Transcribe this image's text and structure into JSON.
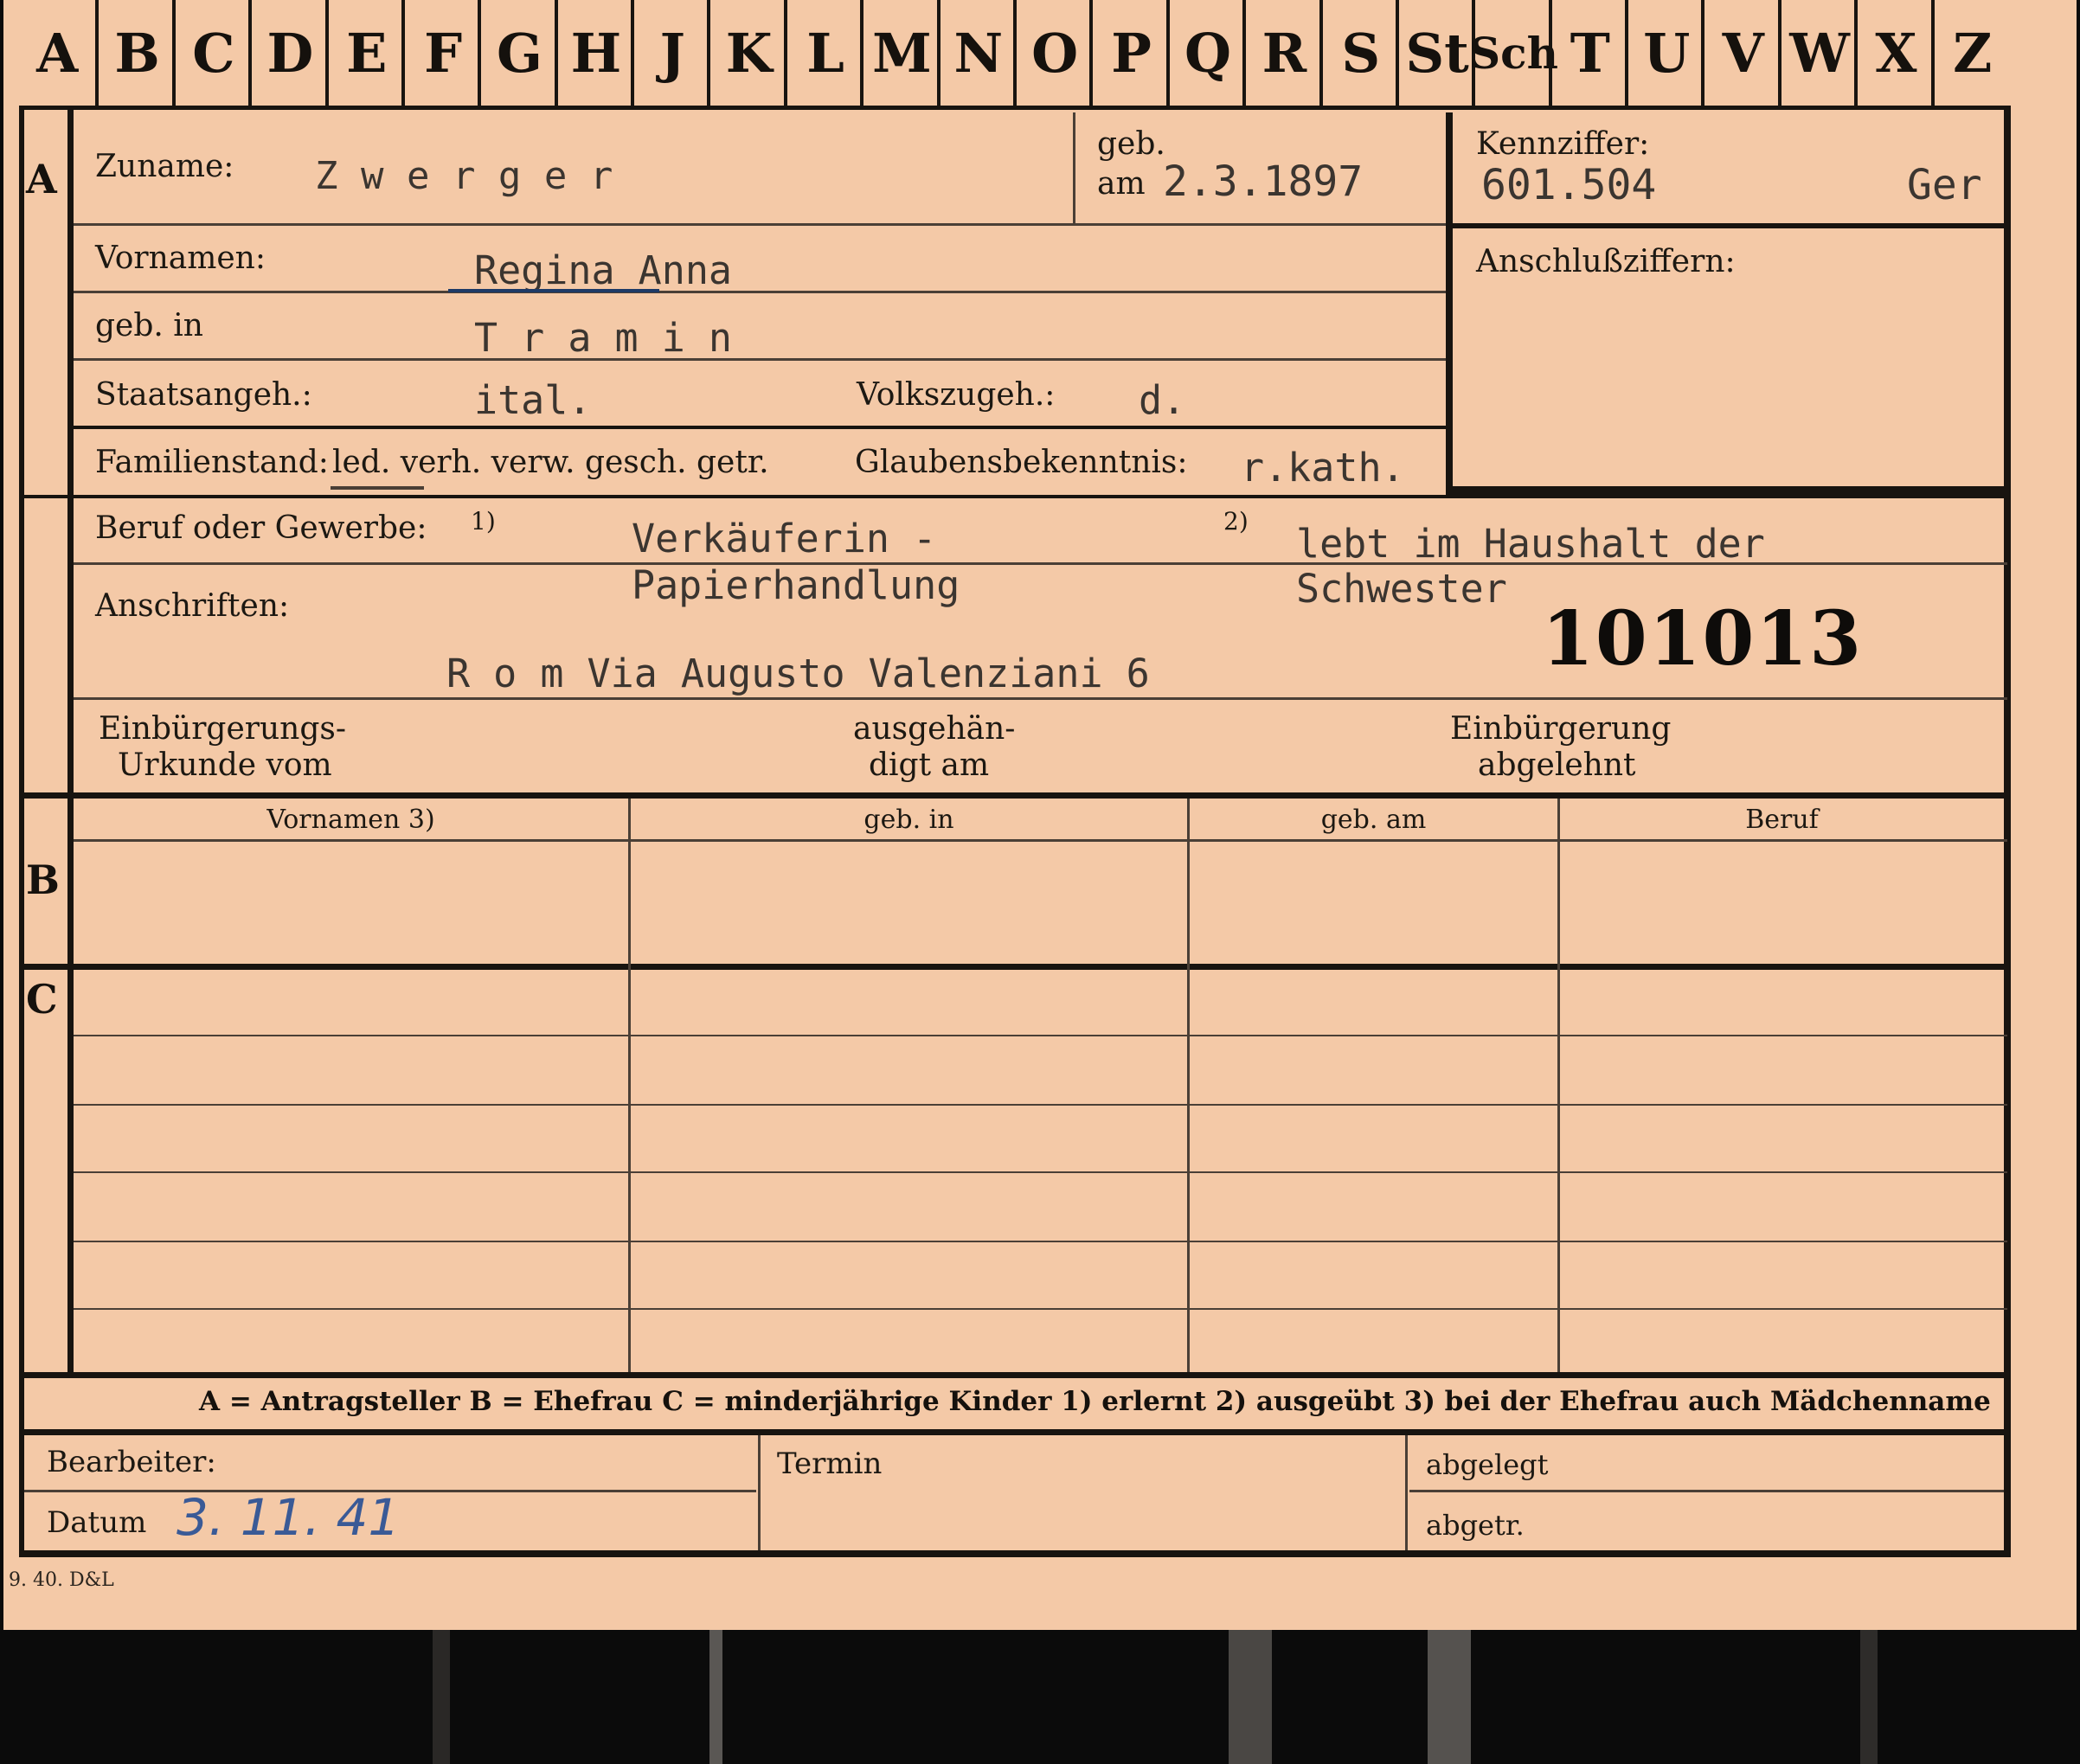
{
  "alphabet": [
    "A",
    "B",
    "C",
    "D",
    "E",
    "F",
    "G",
    "H",
    "J",
    "K",
    "L",
    "M",
    "N",
    "O",
    "P",
    "Q",
    "R",
    "S",
    "St",
    "Sch",
    "T",
    "U",
    "V",
    "W",
    "X",
    "Z"
  ],
  "sections": {
    "a": "A",
    "b": "B",
    "c": "C"
  },
  "labels": {
    "zuname": "Zuname:",
    "geb_top": "geb.",
    "geb_am": "am",
    "kennziffer": "Kennziffer:",
    "anschlussziffern": "Anschlußziffern:",
    "vornamen": "Vornamen:",
    "geb_in": "geb. in",
    "staatsangeh": "Staatsangeh.:",
    "volkszugeh": "Volkszugeh.:",
    "familienstand": "Familienstand:",
    "familienstand_options": "led. verh. verw. gesch. getr.",
    "glaubens": "Glaubensbekenntnis:",
    "beruf": "Beruf oder Gewerbe:",
    "beruf_note1": "1)",
    "beruf_note2": "2)",
    "anschriften": "Anschriften:",
    "einb_urkunde_1": "Einbürgerungs-",
    "einb_urkunde_2": "Urkunde vom",
    "ausgehaend_1": "ausgehän-",
    "ausgehaend_2": "digt am",
    "einb_abgelehnt_1": "Einbürgerung",
    "einb_abgelehnt_2": "abgelehnt",
    "bearbeiter": "Bearbeiter:",
    "datum": "Datum",
    "termin": "Termin",
    "abgelegt": "abgelegt",
    "abgetr": "abgetr.",
    "printer_mark": "9. 40. D&L"
  },
  "table_headers": [
    "Vornamen 3)",
    "geb. in",
    "geb. am",
    "Beruf"
  ],
  "legend": "A = Antragsteller   B = Ehefrau   C = minderjährige Kinder   1) erlernt   2) ausgeübt   3) bei der Ehefrau auch Mädchenname",
  "values": {
    "zuname": "Z w e r g e r",
    "geb_date": "2.3.1897",
    "kennziffer": "601.504",
    "kennziffer_suffix": "Ger",
    "vornamen": "Regina Anna",
    "geb_in": "T r a m i n",
    "staatsangeh": "ital.",
    "volkszugeh": "d.",
    "glaubens": "r.kath.",
    "beruf_erlernt_1": "Verkäuferin -",
    "beruf_erlernt_2": "Papierhandlung",
    "beruf_ausgeuebt_1": "lebt im Haushalt der",
    "beruf_ausgeuebt_2": "Schwester",
    "stamp_number": "101013",
    "anschrift": "R o m  Via Augusto Valenziani 6",
    "datum": "3. 11. 41"
  }
}
